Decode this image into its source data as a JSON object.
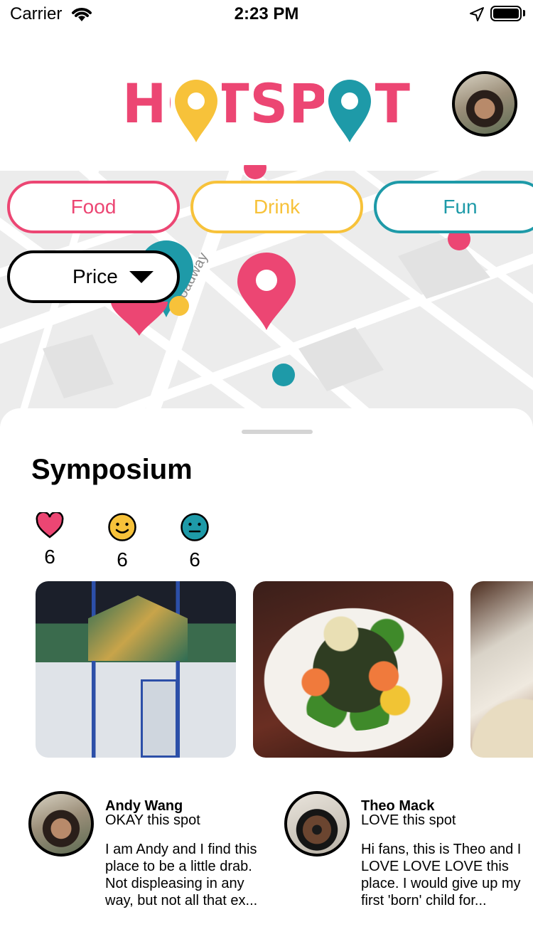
{
  "status_bar": {
    "carrier": "Carrier",
    "time": "2:23 PM"
  },
  "header": {
    "logo_text": "HOTSPOT"
  },
  "map": {
    "road_label": "Broadway"
  },
  "filters": [
    {
      "label": "Food",
      "color": "#ec4673"
    },
    {
      "label": "Drink",
      "color": "#f7c23a"
    },
    {
      "label": "Fun",
      "color": "#1e9aa8"
    }
  ],
  "price_filter": {
    "label": "Price"
  },
  "place": {
    "name": "Symposium",
    "reactions": [
      {
        "icon": "heart-icon",
        "count": "6"
      },
      {
        "icon": "smiley-icon",
        "count": "6"
      },
      {
        "icon": "neutral-face-icon",
        "count": "6"
      }
    ]
  },
  "reviews": [
    {
      "name": "Andy Wang",
      "verdict": "OKAY this spot",
      "body": "I am Andy and I find this place to be a little drab. Not displeasing in any way, but not all that ex..."
    },
    {
      "name": "Theo Mack",
      "verdict": "LOVE this spot",
      "body": "Hi fans, this is Theo and I LOVE LOVE LOVE this place. I would give up my first 'born' child for..."
    }
  ],
  "colors": {
    "pink": "#ec4673",
    "yellow": "#f7c23a",
    "teal": "#1e9aa8"
  }
}
